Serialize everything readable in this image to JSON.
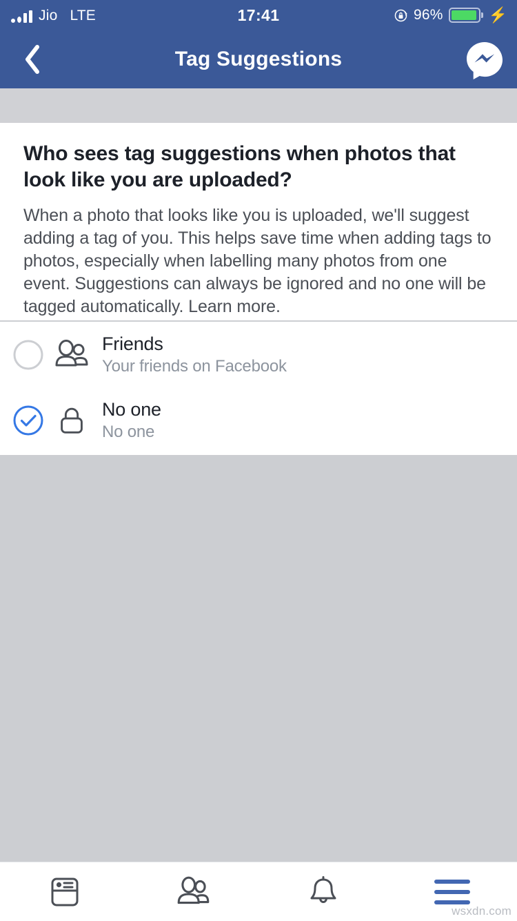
{
  "status_bar": {
    "carrier": "Jio",
    "network": "LTE",
    "time": "17:41",
    "battery_percent": "96%",
    "battery_level": 96,
    "charging": true,
    "rotation_lock": true,
    "signal_icon": "signal-bars-icon",
    "bolt_glyph": "⚡"
  },
  "nav": {
    "title": "Tag Suggestions",
    "back_icon": "chevron-left-icon",
    "messenger_icon": "messenger-icon"
  },
  "info": {
    "heading": "Who sees tag suggestions when photos that look like you are uploaded?",
    "body": "When a photo that looks like you is uploaded, we'll suggest adding a tag of you. This helps save time when adding tags to photos, especially when labelling many photos from one event. Suggestions can always be ignored and no one will be tagged automatically. Learn more."
  },
  "options": [
    {
      "title": "Friends",
      "subtitle": "Your friends on Facebook",
      "icon": "friends-icon",
      "selected": false
    },
    {
      "title": "No one",
      "subtitle": "No one",
      "icon": "lock-icon",
      "selected": true
    }
  ],
  "tabbar": {
    "items": [
      {
        "icon": "news-feed-icon",
        "active": false
      },
      {
        "icon": "friends-icon",
        "active": false
      },
      {
        "icon": "notifications-bell-icon",
        "active": false
      },
      {
        "icon": "menu-hamburger-icon",
        "active": true
      }
    ]
  },
  "watermark": "wsxdn.com",
  "colors": {
    "header_blue": "#3b5998",
    "accent_blue": "#4267b2",
    "grey_bg": "#ccced2",
    "text_primary": "#1d2129",
    "text_secondary": "#4b4f56",
    "text_muted": "#8d949e",
    "battery_green": "#4cd964"
  }
}
